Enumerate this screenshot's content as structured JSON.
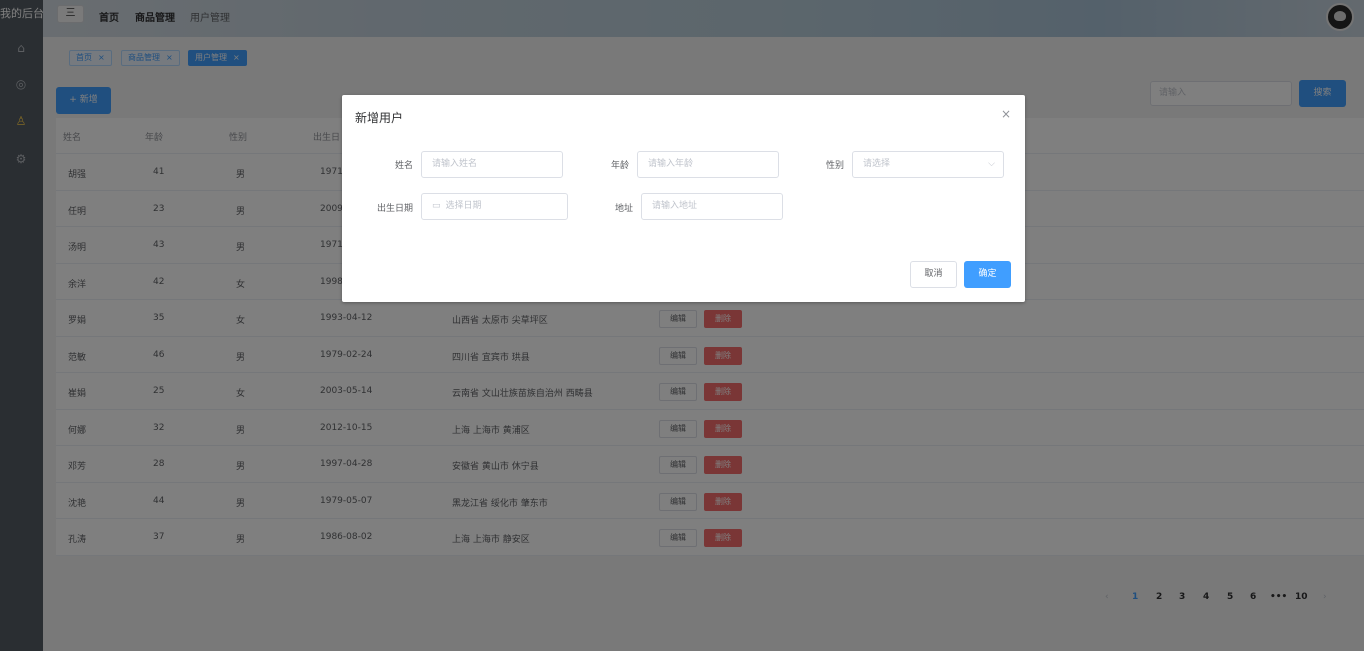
{
  "app": {
    "brand": "我的后台"
  },
  "header": {
    "menu_icon": "三",
    "nav": [
      "首页",
      "商品管理",
      "用户管理"
    ]
  },
  "tags": [
    {
      "label": "首页",
      "close": "×"
    },
    {
      "label": "商品管理",
      "close": "×"
    },
    {
      "label": "用户管理",
      "close": "×"
    }
  ],
  "toolbar": {
    "add_label": "+ 新增",
    "search_placeholder": "请输入",
    "search_label": "搜索"
  },
  "table": {
    "columns": [
      "姓名",
      "年龄",
      "性别",
      "出生日"
    ],
    "edit_label": "编辑",
    "delete_label": "删除",
    "rows": [
      {
        "name": "胡强",
        "age": "41",
        "sex": "男",
        "birth": "1971-",
        "addr": ""
      },
      {
        "name": "任明",
        "age": "23",
        "sex": "男",
        "birth": "2009-",
        "addr": ""
      },
      {
        "name": "汤明",
        "age": "43",
        "sex": "男",
        "birth": "1971-",
        "addr": ""
      },
      {
        "name": "余洋",
        "age": "42",
        "sex": "女",
        "birth": "1998-",
        "addr": ""
      },
      {
        "name": "罗娟",
        "age": "35",
        "sex": "女",
        "birth": "1993-04-12",
        "addr": "山西省 太原市 尖草坪区"
      },
      {
        "name": "范敏",
        "age": "46",
        "sex": "男",
        "birth": "1979-02-24",
        "addr": "四川省 宜宾市 珙县"
      },
      {
        "name": "崔娟",
        "age": "25",
        "sex": "女",
        "birth": "2003-05-14",
        "addr": "云南省 文山壮族苗族自治州 西畴县"
      },
      {
        "name": "何娜",
        "age": "32",
        "sex": "男",
        "birth": "2012-10-15",
        "addr": "上海 上海市 黄浦区"
      },
      {
        "name": "邓芳",
        "age": "28",
        "sex": "男",
        "birth": "1997-04-28",
        "addr": "安徽省 黄山市 休宁县"
      },
      {
        "name": "沈艳",
        "age": "44",
        "sex": "男",
        "birth": "1979-05-07",
        "addr": "黑龙江省 绥化市 肇东市"
      },
      {
        "name": "孔涛",
        "age": "37",
        "sex": "男",
        "birth": "1986-08-02",
        "addr": "上海 上海市 静安区"
      }
    ]
  },
  "pagination": {
    "prev": "‹",
    "pages": [
      "1",
      "2",
      "3",
      "4",
      "5",
      "6",
      "•••",
      "10"
    ],
    "next": "›",
    "current": "1"
  },
  "dialog": {
    "title": "新增用户",
    "close": "×",
    "fields": {
      "name": {
        "label": "姓名",
        "placeholder": "请输入姓名"
      },
      "age": {
        "label": "年龄",
        "placeholder": "请输入年龄"
      },
      "sex": {
        "label": "性别",
        "placeholder": "请选择"
      },
      "birth": {
        "label": "出生日期",
        "placeholder": "选择日期"
      },
      "addr": {
        "label": "地址",
        "placeholder": "请输入地址"
      }
    },
    "cancel_label": "取消",
    "ok_label": "确定"
  },
  "colors": {
    "primary": "#409eff",
    "danger": "#f56c6c",
    "sidebar": "#545c64"
  }
}
